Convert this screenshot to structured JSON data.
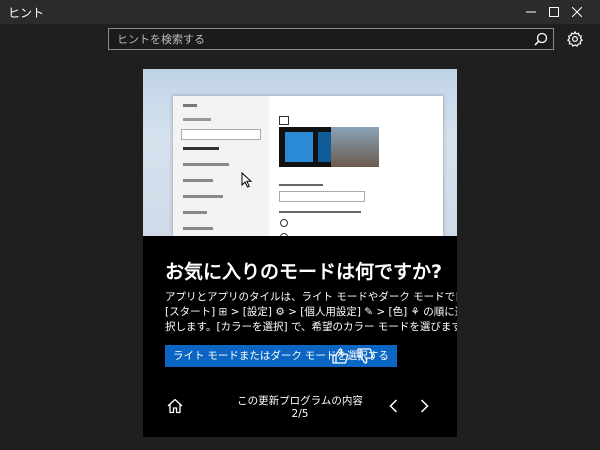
{
  "window": {
    "title": "ヒント"
  },
  "search": {
    "placeholder": "ヒントを検索する"
  },
  "card": {
    "heading": "お気に入りのモードは何ですか?",
    "body_lines": [
      "アプリとアプリのタイルは、ライト モードやダーク モードで目立たせます。",
      "[スタート] ⊞ > [設定] ⚙ > [個人用設定] ✎ > [色] ⚘ の順に選",
      "択します。[カラーを選択] で、希望のカラー モードを選びます。"
    ],
    "action_label": "ライト モードまたはダーク モードを選択する",
    "footer_title": "この更新プログラムの内容",
    "page": "2/5"
  },
  "icons": {
    "minimize": "minimize-icon",
    "maximize": "maximize-icon",
    "close": "close-icon",
    "search": "search-icon",
    "settings": "gear-icon",
    "like": "thumbs-up-icon",
    "dislike": "thumbs-down-icon",
    "home": "home-icon",
    "previous": "chevron-left-icon",
    "next": "chevron-right-icon"
  },
  "colors": {
    "background": "#1f1f1f",
    "titlebar": "#2b2b2b",
    "card": "#000000",
    "accent": "#0a66c2"
  }
}
